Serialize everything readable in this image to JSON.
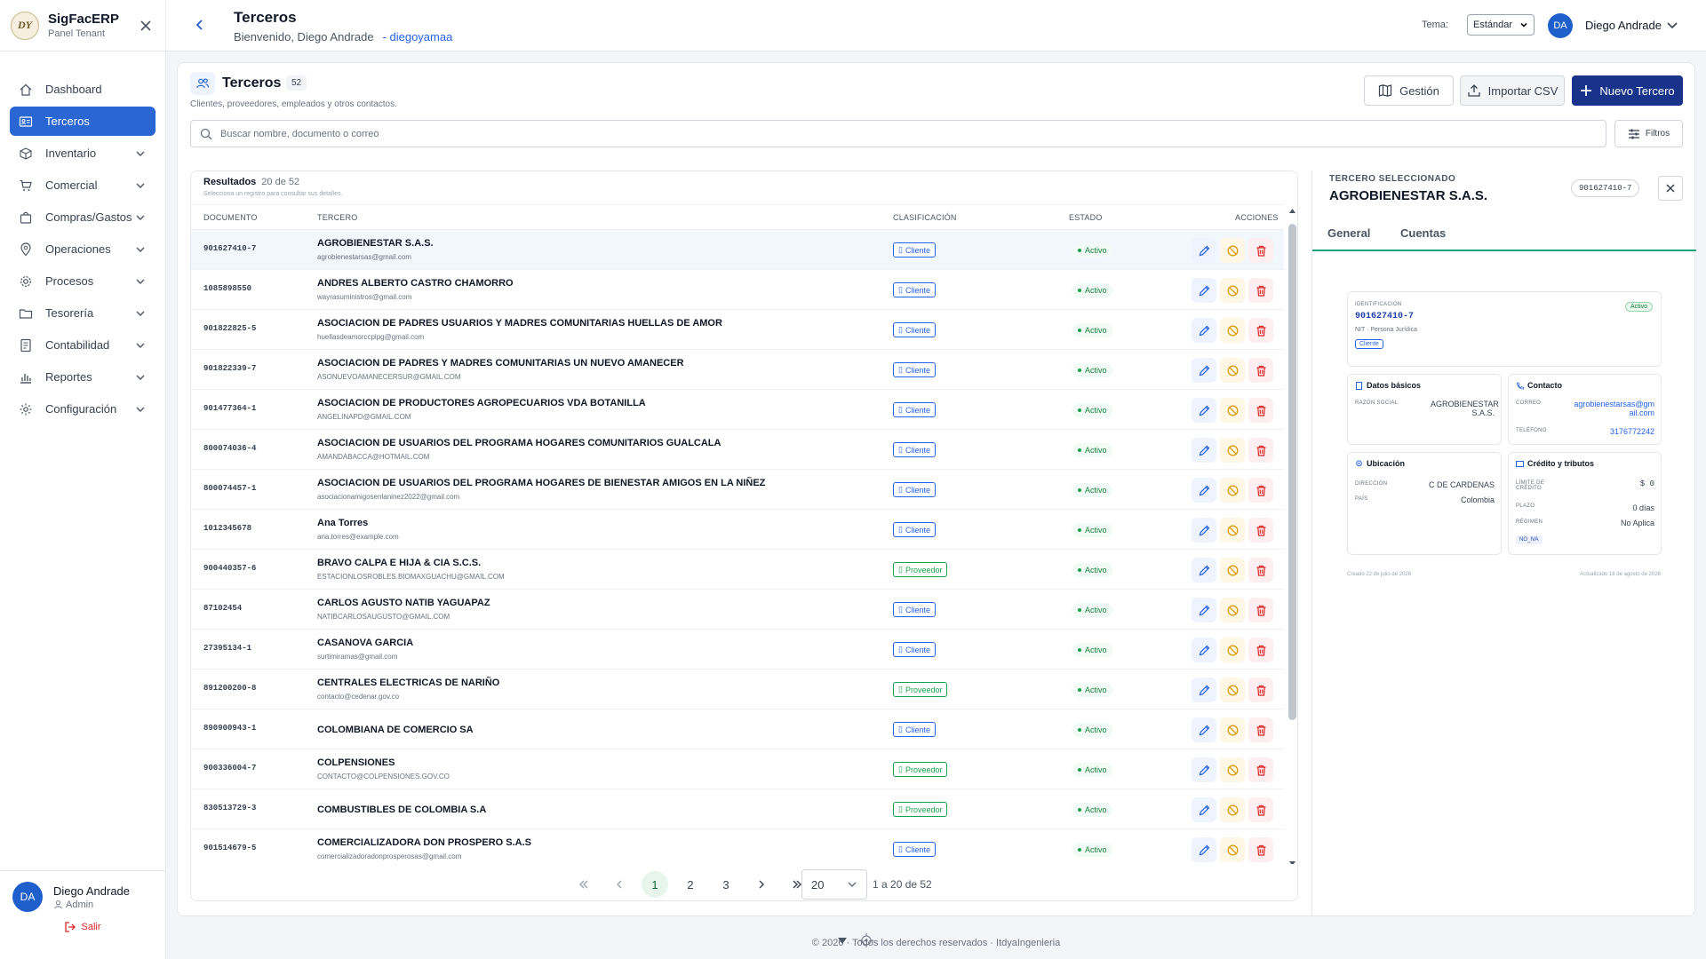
{
  "sidebar": {
    "brand_title": "SigFacERP",
    "brand_subtitle": "Panel Tenant",
    "logo_text": "DY",
    "items": [
      {
        "label": "Dashboard",
        "icon": "home-icon"
      },
      {
        "label": "Terceros",
        "icon": "id-card-icon",
        "active": true
      },
      {
        "label": "Inventario",
        "icon": "box-icon"
      },
      {
        "label": "Comercial",
        "icon": "cart-icon"
      },
      {
        "label": "Compras/Gastos",
        "icon": "bag-icon"
      },
      {
        "label": "Operaciones",
        "icon": "pin-icon"
      },
      {
        "label": "Procesos",
        "icon": "gear-icon"
      },
      {
        "label": "Tesorería",
        "icon": "folder-icon"
      },
      {
        "label": "Contabilidad",
        "icon": "ledger-icon"
      },
      {
        "label": "Reportes",
        "icon": "bar-chart-icon"
      },
      {
        "label": "Configuración",
        "icon": "settings-icon"
      }
    ],
    "user": {
      "initials": "DA",
      "name": "Diego Andrade",
      "role": "Admin",
      "logout": "Salir"
    }
  },
  "topbar": {
    "title": "Terceros",
    "welcome": "Bienvenido, Diego Andrade",
    "username_link": "- diegoyamaa",
    "theme_label": "Tema:",
    "theme_value": "Estándar",
    "user_initials": "DA",
    "user_name": "Diego Andrade"
  },
  "page": {
    "title": "Terceros",
    "count": "52",
    "subtitle": "Clientes, proveedores, empleados y otros contactos.",
    "btn_gestion": "Gestión",
    "btn_import": "Importar CSV",
    "btn_new": "Nuevo Tercero",
    "search_placeholder": "Buscar nombre, documento o correo",
    "btn_filters": "Filtros"
  },
  "table": {
    "results_label": "Resultados",
    "results_count": "20 de 52",
    "hint": "Selecciona un registro para consultar sus detalles.",
    "columns": {
      "doc": "DOCUMENTO",
      "name": "TERCERO",
      "class": "CLASIFICACIÓN",
      "status": "ESTADO",
      "actions": "ACCIONES"
    },
    "rows": [
      {
        "doc": "901627410-7",
        "name": "AGROBIENESTAR S.A.S.",
        "email": "agrobienestarsas@gmail.com",
        "class": "Cliente",
        "status": "Activo"
      },
      {
        "doc": "1085898550",
        "name": "ANDRES ALBERTO CASTRO CHAMORRO",
        "email": "wayrasuministros@gmail.com",
        "class": "Cliente",
        "status": "Activo"
      },
      {
        "doc": "901822825-5",
        "name": "ASOCIACION DE PADRES USUARIOS Y MADRES COMUNITARIAS HUELLAS DE AMOR",
        "email": "huellasdeamorccpipg@gmail.com",
        "class": "Cliente",
        "status": "Activo"
      },
      {
        "doc": "901822339-7",
        "name": "ASOCIACION DE PADRES Y MADRES COMUNITARIAS UN NUEVO AMANECER",
        "email": "ASONUEVOAMANECERSUR@GMAIL.COM",
        "class": "Cliente",
        "status": "Activo"
      },
      {
        "doc": "901477364-1",
        "name": "ASOCIACION DE PRODUCTORES AGROPECUARIOS VDA BOTANILLA",
        "email": "ANGELINAPD@GMAIL.COM",
        "class": "Cliente",
        "status": "Activo"
      },
      {
        "doc": "800074036-4",
        "name": "ASOCIACION DE USUARIOS DEL PROGRAMA HOGARES COMUNITARIOS GUALCALA",
        "email": "AMANDABACCA@HOTMAIL.COM",
        "class": "Cliente",
        "status": "Activo"
      },
      {
        "doc": "800074457-1",
        "name": "ASOCIACION DE USUARIOS DEL PROGRAMA HOGARES DE BIENESTAR AMIGOS EN LA NIÑEZ",
        "email": "asociacionamigosenlaninez2022@gmail.com",
        "class": "Cliente",
        "status": "Activo"
      },
      {
        "doc": "1012345678",
        "name": "Ana Torres",
        "email": "ana.torres@example.com",
        "class": "Cliente",
        "status": "Activo"
      },
      {
        "doc": "900440357-6",
        "name": "BRAVO CALPA E HIJA & CIA S.C.S.",
        "email": "ESTACIONLOSROBLES.BIOMAXGUACHU@GMAIL.COM",
        "class": "Proveedor",
        "status": "Activo"
      },
      {
        "doc": "87102454",
        "name": "CARLOS AGUSTO NATIB YAGUAPAZ",
        "email": "NATIBCARLOSAUGUSTO@GMAIL.COM",
        "class": "Cliente",
        "status": "Activo"
      },
      {
        "doc": "27395134-1",
        "name": "CASANOVA GARCIA",
        "email": "surtimiramas@gmail.com",
        "class": "Cliente",
        "status": "Activo"
      },
      {
        "doc": "891200200-8",
        "name": "CENTRALES ELECTRICAS DE NARIÑO",
        "email": "contacto@cedenar.gov.co",
        "class": "Proveedor",
        "status": "Activo"
      },
      {
        "doc": "890900943-1",
        "name": "COLOMBIANA DE COMERCIO SA",
        "email": "",
        "class": "Cliente",
        "status": "Activo"
      },
      {
        "doc": "900336004-7",
        "name": "COLPENSIONES",
        "email": "CONTACTO@COLPENSIONES.GOV.CO",
        "class": "Proveedor",
        "status": "Activo"
      },
      {
        "doc": "830513729-3",
        "name": "COMBUSTIBLES DE COLOMBIA S.A",
        "email": "",
        "class": "Proveedor",
        "status": "Activo"
      },
      {
        "doc": "901514679-5",
        "name": "COMERCIALIZADORA DON PROSPERO S.A.S",
        "email": "comercializadoradonprosperosas@gmail.com",
        "class": "Cliente",
        "status": "Activo"
      }
    ]
  },
  "pagination": {
    "pages": [
      "1",
      "2",
      "3"
    ],
    "current": "1",
    "per_page": "20",
    "range": "1 a 20 de 52"
  },
  "detail": {
    "kicker": "TERCERO SELECCIONADO",
    "name": "AGROBIENESTAR S.A.S.",
    "code": "901627410-7",
    "tabs": [
      "General",
      "Cuentas"
    ],
    "id_label": "IDENTIFICACIÓN",
    "id_value": "901627410-7",
    "id_type": "NIT · Persona Jurídica",
    "status": "Activo",
    "class_badge": "Cliente",
    "basic": {
      "title": "Datos básicos",
      "razon_label": "RAZÓN SOCIAL",
      "razon_value": "AGROBIENESTAR S.A.S."
    },
    "contact": {
      "title": "Contacto",
      "email_label": "CORREO",
      "email_value": "agrobienestarsas@gmail.com",
      "phone_label": "TELÉFONO",
      "phone_value": "3176772242"
    },
    "location": {
      "title": "Ubicación",
      "address_label": "DIRECCIÓN",
      "address_value": "C DE CARDENAS",
      "country_label": "PAÍS",
      "country_value": "Colombia"
    },
    "credit": {
      "title": "Crédito y tributos",
      "limit_label": "LÍMITE DE CRÉDITO",
      "limit_value": "$ 0",
      "term_label": "PLAZO",
      "term_value": "0 días",
      "regime_label": "RÉGIMEN",
      "regime_value": "No Aplica",
      "tax_badge": "NO_IVA"
    },
    "created": "Creado 22 de julio de 2026",
    "updated": "Actualizado 18 de agosto de 2026"
  },
  "footer": {
    "text": "© 2026 · Todos los derechos reservados · ItdyaIngenieria"
  }
}
